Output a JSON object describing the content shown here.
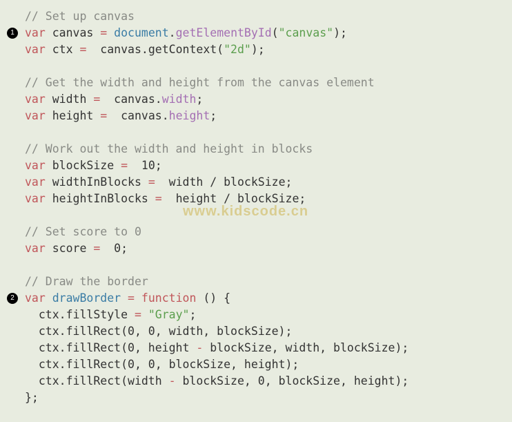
{
  "watermark": "www.kidscode.cn",
  "markers": {
    "m1": "1",
    "m2": "2"
  },
  "lines": {
    "c1": "// Set up canvas",
    "l2a": "var ",
    "l2b": "canvas ",
    "l2c": "= ",
    "l2d": "document",
    "l2e": ".",
    "l2f": "getElementById",
    "l2g": "(",
    "l2h": "\"canvas\"",
    "l2i": ");",
    "l3a": "var ",
    "l3b": "ctx ",
    "l3c": "= ",
    "l3d": " canvas.getContext(",
    "l3e": "\"2d\"",
    "l3f": ");",
    "c2": "// Get the width and height from the canvas element",
    "l5a": "var ",
    "l5b": "width ",
    "l5c": "= ",
    "l5d": " canvas.",
    "l5e": "width",
    "l5f": ";",
    "l6a": "var ",
    "l6b": "height ",
    "l6c": "= ",
    "l6d": " canvas.",
    "l6e": "height",
    "l6f": ";",
    "c3": "// Work out the width and height in blocks",
    "l8a": "var ",
    "l8b": "blockSize ",
    "l8c": "= ",
    "l8d": " 10;",
    "l9a": "var ",
    "l9b": "widthInBlocks ",
    "l9c": "= ",
    "l9d": " width / blockSize;",
    "l10a": "var ",
    "l10b": "heightInBlocks ",
    "l10c": "= ",
    "l10d": " height / blockSize;",
    "c4": "// Set score to 0",
    "l12a": "var ",
    "l12b": "score ",
    "l12c": "= ",
    "l12d": " 0;",
    "c5": "// Draw the border",
    "l14a": "var ",
    "l14b": "drawBorder ",
    "l14c": "= ",
    "l14d": "function ",
    "l14e": "() {",
    "l15a": "  ctx.fillStyle ",
    "l15b": "= ",
    "l15c": "\"Gray\"",
    "l15d": ";",
    "l16a": "  ctx.fillRect(0, 0, width, blockSize);",
    "l17a": "  ctx.fillRect(0, height ",
    "l17b": "- ",
    "l17c": "blockSize, width, blockSize);",
    "l18a": "  ctx.fillRect(0, 0, blockSize, height);",
    "l19a": "  ctx.fillRect(width ",
    "l19b": "- ",
    "l19c": "blockSize, 0, blockSize, height);",
    "l20a": "};"
  }
}
